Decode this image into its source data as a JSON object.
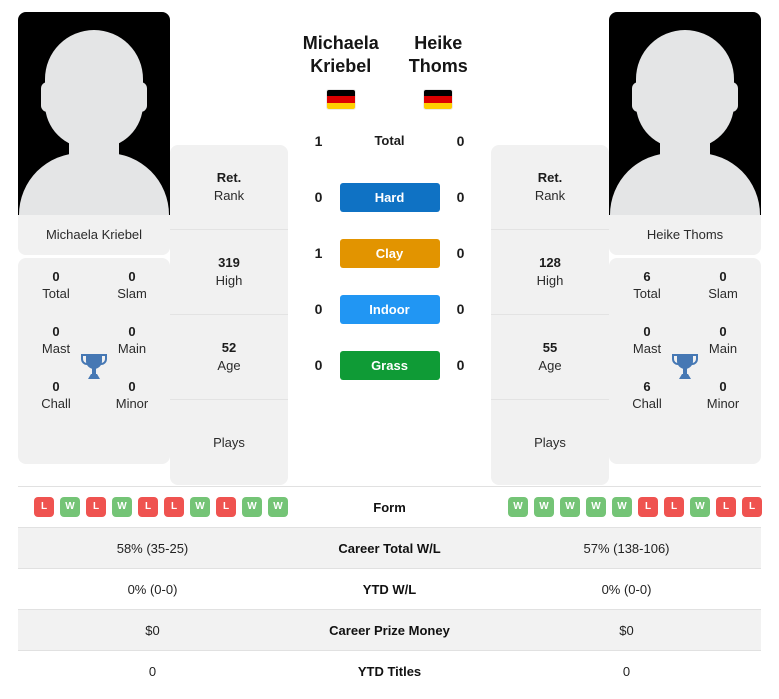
{
  "players": {
    "left": {
      "name": "Michaela Kriebel",
      "name_line1": "Michaela",
      "name_line2": "Kriebel",
      "country_code": "DE",
      "flag_colors": [
        "#000000",
        "#dd0000",
        "#ffce00"
      ],
      "photo_alt": "player-photo-placeholder",
      "titles": [
        {
          "value": "0",
          "label": "Total"
        },
        {
          "value": "0",
          "label": "Slam"
        },
        {
          "value": "0",
          "label": "Mast"
        },
        {
          "value": "0",
          "label": "Main"
        },
        {
          "value": "0",
          "label": "Chall"
        },
        {
          "value": "0",
          "label": "Minor"
        }
      ],
      "info": [
        {
          "value": "Ret.",
          "label": "Rank"
        },
        {
          "value": "319",
          "label": "High"
        },
        {
          "value": "52",
          "label": "Age"
        },
        {
          "value": "",
          "label": "Plays"
        }
      ],
      "form": [
        "L",
        "W",
        "L",
        "W",
        "L",
        "L",
        "W",
        "L",
        "W",
        "W"
      ],
      "career_total_wl": "58% (35-25)",
      "ytd_wl": "0% (0-0)",
      "career_prize_money": "$0",
      "ytd_titles": "0"
    },
    "right": {
      "name": "Heike Thoms",
      "name_line1": "Heike Thoms",
      "name_line2": "",
      "country_code": "DE",
      "flag_colors": [
        "#000000",
        "#dd0000",
        "#ffce00"
      ],
      "photo_alt": "player-photo-placeholder",
      "titles": [
        {
          "value": "6",
          "label": "Total"
        },
        {
          "value": "0",
          "label": "Slam"
        },
        {
          "value": "0",
          "label": "Mast"
        },
        {
          "value": "0",
          "label": "Main"
        },
        {
          "value": "6",
          "label": "Chall"
        },
        {
          "value": "0",
          "label": "Minor"
        }
      ],
      "info": [
        {
          "value": "Ret.",
          "label": "Rank"
        },
        {
          "value": "128",
          "label": "High"
        },
        {
          "value": "55",
          "label": "Age"
        },
        {
          "value": "",
          "label": "Plays"
        }
      ],
      "form": [
        "W",
        "W",
        "W",
        "W",
        "W",
        "L",
        "L",
        "W",
        "L",
        "L"
      ],
      "career_total_wl": "57% (138-106)",
      "ytd_wl": "0% (0-0)",
      "career_prize_money": "$0",
      "ytd_titles": "0"
    }
  },
  "h2h": {
    "total": {
      "label": "Total",
      "left": "1",
      "right": "0"
    },
    "surfaces": [
      {
        "label": "Hard",
        "left": "0",
        "right": "0",
        "color": "#0f72c4"
      },
      {
        "label": "Clay",
        "left": "1",
        "right": "0",
        "color": "#e29400"
      },
      {
        "label": "Indoor",
        "left": "0",
        "right": "0",
        "color": "#2196f3"
      },
      {
        "label": "Grass",
        "left": "0",
        "right": "0",
        "color": "#0f9b36"
      }
    ]
  },
  "table": {
    "rows": [
      {
        "label": "Form",
        "left": "",
        "right": ""
      },
      {
        "label": "Career Total W/L",
        "left": "58% (35-25)",
        "right": "57% (138-106)"
      },
      {
        "label": "YTD W/L",
        "left": "0% (0-0)",
        "right": "0% (0-0)"
      },
      {
        "label": "Career Prize Money",
        "left": "$0",
        "right": "$0"
      },
      {
        "label": "YTD Titles",
        "left": "0",
        "right": "0"
      }
    ]
  },
  "colors": {
    "win_badge": "#74c476",
    "loss_badge": "#ef5350",
    "trophy": "#4678b4",
    "card_bg": "#f1f1f1",
    "row_shaded": "#f2f2f2"
  },
  "icons": {
    "trophy": "trophy-icon"
  }
}
